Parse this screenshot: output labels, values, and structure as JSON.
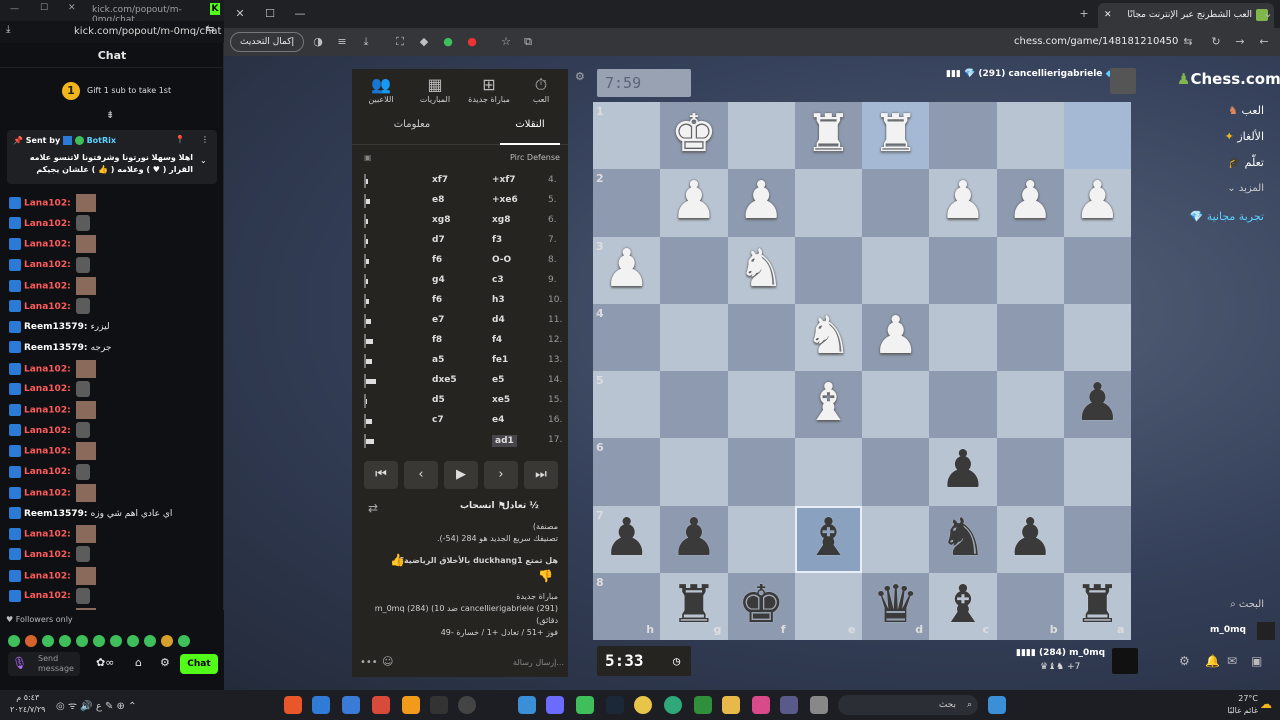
{
  "kick": {
    "window_title": "kick.com/popout/m-0mq/chat...",
    "address": "kick.com/popout/m-0mq/chat",
    "panel_title": "Chat",
    "gift_text": "Gift 1 sub to take 1st",
    "gift_coin": "1",
    "pinned": {
      "sent_by": "Sent by",
      "sender": "BotRix",
      "message": "اهلا وسهلا نورتونا وشرفتونا لاتنسو علامه القرار ( ♥ ) وعلامه ( 👍 ) علشان يجيكم اشعار ليفيتنا"
    },
    "messages": [
      {
        "user": "Lana102",
        "text": ""
      },
      {
        "user": "Lana102",
        "text": ""
      },
      {
        "user": "Lana102",
        "text": ""
      },
      {
        "user": "Lana102",
        "text": ""
      },
      {
        "user": "Lana102",
        "text": ""
      },
      {
        "user": "Lana102",
        "text": ""
      },
      {
        "user": "Reem13579",
        "text": "ليزرء"
      },
      {
        "user": "Reem13579",
        "text": "جرجه"
      },
      {
        "user": "Lana102",
        "text": ""
      },
      {
        "user": "Lana102",
        "text": ""
      },
      {
        "user": "Lana102",
        "text": ""
      },
      {
        "user": "Lana102",
        "text": ""
      },
      {
        "user": "Lana102",
        "text": ""
      },
      {
        "user": "Lana102",
        "text": ""
      },
      {
        "user": "Lana102",
        "text": ""
      },
      {
        "user": "Reem13579",
        "text": "اي عادي اهم شي وزه"
      },
      {
        "user": "Lana102",
        "text": ""
      },
      {
        "user": "Lana102",
        "text": ""
      },
      {
        "user": "Lana102",
        "text": ""
      },
      {
        "user": "Lana102",
        "text": ""
      },
      {
        "user": "Lana102",
        "text": ""
      },
      {
        "user": "Lana102",
        "text": ""
      }
    ],
    "followers_only": "Followers only",
    "send_placeholder": "Send message",
    "chat_button": "Chat"
  },
  "browser": {
    "tab_title": "العب الشطرنج عبر الإنترنت مجانًا",
    "url": "chess.com/game/148181210450",
    "update_button": "إكمال التحديث"
  },
  "game": {
    "top_clock": "7:59",
    "bottom_clock": "5:33",
    "top_player": "cancellierigabriele",
    "top_rating": "(291)",
    "bottom_player": "m_0mq",
    "bottom_rating": "(284)",
    "bottom_material": "+7",
    "opening": "Pirc Defense",
    "tabs": {
      "play": "العب",
      "new_game": "مباراة جديدة",
      "games": "المباريات",
      "players": "اللاعبين"
    },
    "subtabs": {
      "moves": "النقلات",
      "info": "معلومات"
    },
    "moves": [
      {
        "n": "4.",
        "w": "+xf7",
        "b": "xf7"
      },
      {
        "n": "5.",
        "w": "+xe6",
        "b": "e8"
      },
      {
        "n": "6.",
        "w": "xg8",
        "b": "xg8"
      },
      {
        "n": "7.",
        "w": "f3",
        "b": "d7"
      },
      {
        "n": "8.",
        "w": "O-O",
        "b": "f6"
      },
      {
        "n": "9.",
        "w": "c3",
        "b": "g4"
      },
      {
        "n": "10.",
        "w": "h3",
        "b": "f6"
      },
      {
        "n": "11.",
        "w": "d4",
        "b": "e7"
      },
      {
        "n": "12.",
        "w": "f4",
        "b": "f8"
      },
      {
        "n": "13.",
        "w": "fe1",
        "b": "a5"
      },
      {
        "n": "14.",
        "w": "e5",
        "b": "dxe5"
      },
      {
        "n": "15.",
        "w": "xe5",
        "b": "d5"
      },
      {
        "n": "16.",
        "w": "e4",
        "b": "c7"
      },
      {
        "n": "17.",
        "w": "ad1",
        "b": ""
      }
    ],
    "draw": "تعادل",
    "resign": "انسحاب",
    "info_lines": [
      "مصنفة)",
      "تصنيفك سريع الجديد هو 284 (‎-54).",
      "هل تمتع duckhang1 بالأخلاق الرياضية؟",
      "مباراة جديدة",
      "cancellierigabriele (291) ضد m_0mq (284) (10",
      "دقائق)",
      "فوز +51 / تعادل +1 / خسارة -49"
    ],
    "message_placeholder": "إرسال رسالة...",
    "board_files": [
      "h",
      "g",
      "f",
      "e",
      "d",
      "c",
      "b",
      "a"
    ],
    "board_ranks": [
      "1",
      "2",
      "3",
      "4",
      "5",
      "6",
      "7",
      "8"
    ]
  },
  "sidebar": {
    "logo": "Chess.com",
    "items": [
      "العب",
      "الألغاز",
      "تعلّم",
      "المزيد",
      "تجربة مجانية"
    ],
    "search": "البحث",
    "user": "m_0mq"
  },
  "taskbar": {
    "time": "٥:٤٣ م",
    "date": "٢٠٢٤/٧/٢٩",
    "weather": "27°C",
    "weather_desc": "غائم غالبًا",
    "search": "بحث"
  },
  "colors": {
    "light_sq": "#b9c4d3",
    "dark_sq": "#8795aa",
    "kick_green": "#53fc18",
    "chess_panel": "#262421"
  }
}
